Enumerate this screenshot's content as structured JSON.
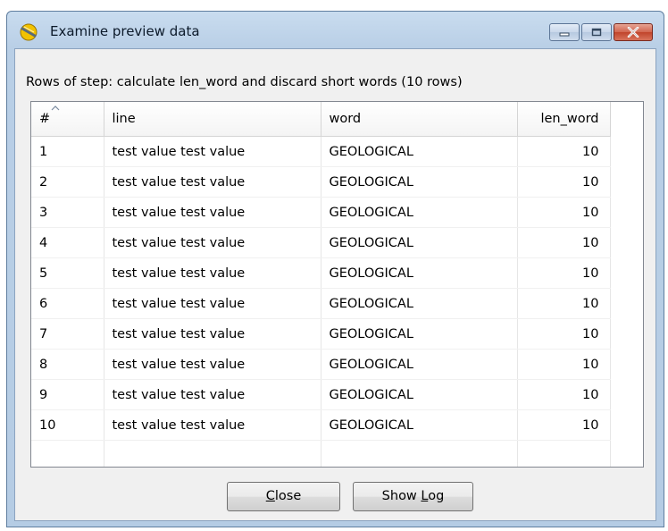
{
  "window": {
    "title": "Examine preview data"
  },
  "caption": "Rows of step: calculate len_word and discard short words (10 rows)",
  "table": {
    "columns": [
      "#",
      "line",
      "word",
      "len_word"
    ],
    "rows": [
      [
        "1",
        "test value test value",
        "GEOLOGICAL",
        "10"
      ],
      [
        "2",
        "test value test value",
        "GEOLOGICAL",
        "10"
      ],
      [
        "3",
        "test value test value",
        "GEOLOGICAL",
        "10"
      ],
      [
        "4",
        "test value test value",
        "GEOLOGICAL",
        "10"
      ],
      [
        "5",
        "test value test value",
        "GEOLOGICAL",
        "10"
      ],
      [
        "6",
        "test value test value",
        "GEOLOGICAL",
        "10"
      ],
      [
        "7",
        "test value test value",
        "GEOLOGICAL",
        "10"
      ],
      [
        "8",
        "test value test value",
        "GEOLOGICAL",
        "10"
      ],
      [
        "9",
        "test value test value",
        "GEOLOGICAL",
        "10"
      ],
      [
        "10",
        "test value test value",
        "GEOLOGICAL",
        "10"
      ]
    ]
  },
  "buttons": {
    "close": {
      "mnemonic": "C",
      "rest": "lose"
    },
    "show_log": {
      "prefix": "Show ",
      "mnemonic": "L",
      "rest": "og"
    }
  },
  "icons": {
    "app": "kettle-spoon-icon",
    "minimize": "minimize-icon",
    "maximize": "maximize-icon",
    "close": "close-icon",
    "sort": "sort-ascending-icon"
  }
}
